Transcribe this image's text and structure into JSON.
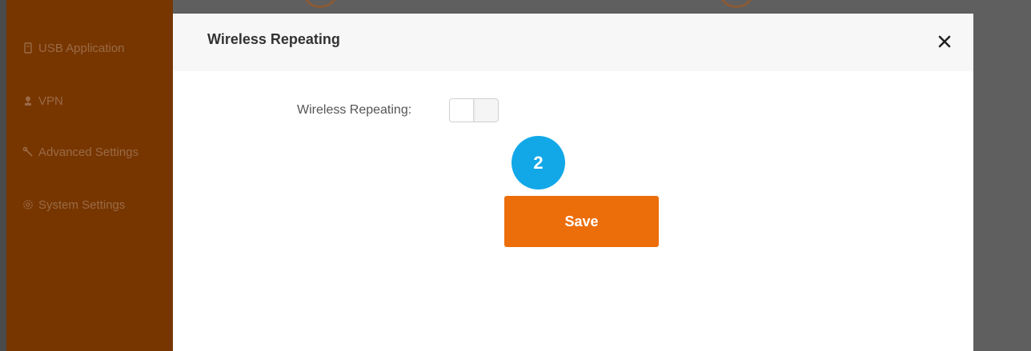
{
  "sidebar": {
    "items": [
      {
        "label": "USB Application",
        "icon": "usb-icon"
      },
      {
        "label": "VPN",
        "icon": "user-icon"
      },
      {
        "label": "Advanced Settings",
        "icon": "wrench-icon"
      },
      {
        "label": "System Settings",
        "icon": "gear-icon"
      }
    ]
  },
  "modal": {
    "title": "Wireless Repeating",
    "close_icon": "close-icon",
    "field_label": "Wireless Repeating:",
    "toggle_on": false,
    "step_number": "2",
    "save_label": "Save"
  },
  "colors": {
    "sidebar_bg": "#773600",
    "overlay_bg": "#5f5f5f",
    "save_button": "#ec6e0b",
    "step_badge": "#12a8e8"
  }
}
